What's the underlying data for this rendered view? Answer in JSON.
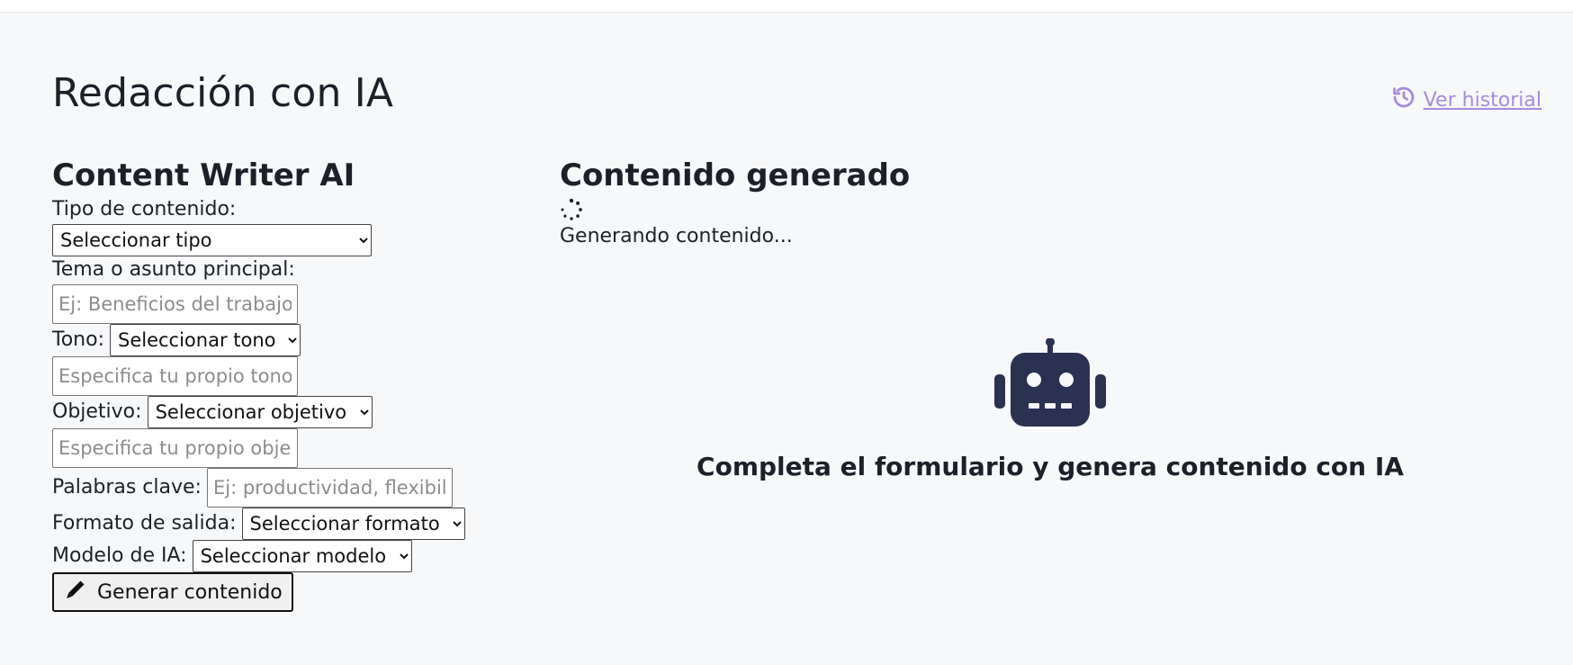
{
  "header": {
    "title": "Redacción con IA",
    "history_link": "Ver historial"
  },
  "form": {
    "title": "Content Writer AI",
    "content_type": {
      "label": "Tipo de contenido:",
      "selected": "Seleccionar tipo"
    },
    "topic": {
      "label": "Tema o asunto principal:",
      "placeholder": "Ej: Beneficios del trabajo remoto"
    },
    "tone": {
      "label": "Tono:",
      "selected": "Seleccionar tono",
      "custom_placeholder": "Especifica tu propio tono"
    },
    "objective": {
      "label": "Objetivo:",
      "selected": "Seleccionar objetivo",
      "custom_placeholder": "Especifica tu propio objetivo"
    },
    "keywords": {
      "label": "Palabras clave:",
      "placeholder": "Ej: productividad, flexibilidad"
    },
    "output_format": {
      "label": "Formato de salida:",
      "selected": "Seleccionar formato"
    },
    "model": {
      "label": "Modelo de IA:",
      "selected": "Seleccionar modelo"
    },
    "submit_label": "Generar contenido"
  },
  "output": {
    "title": "Contenido generado",
    "loading_text": "Generando contenido...",
    "empty_message": "Completa el formulario y genera contenido con IA"
  },
  "colors": {
    "accent_link": "#a78bdb",
    "robot": "#2b3150",
    "background": "#f7f8fa"
  },
  "icons": {
    "history": "history-icon",
    "submit": "pen-icon",
    "loading": "spinner-icon",
    "empty": "robot-icon"
  }
}
